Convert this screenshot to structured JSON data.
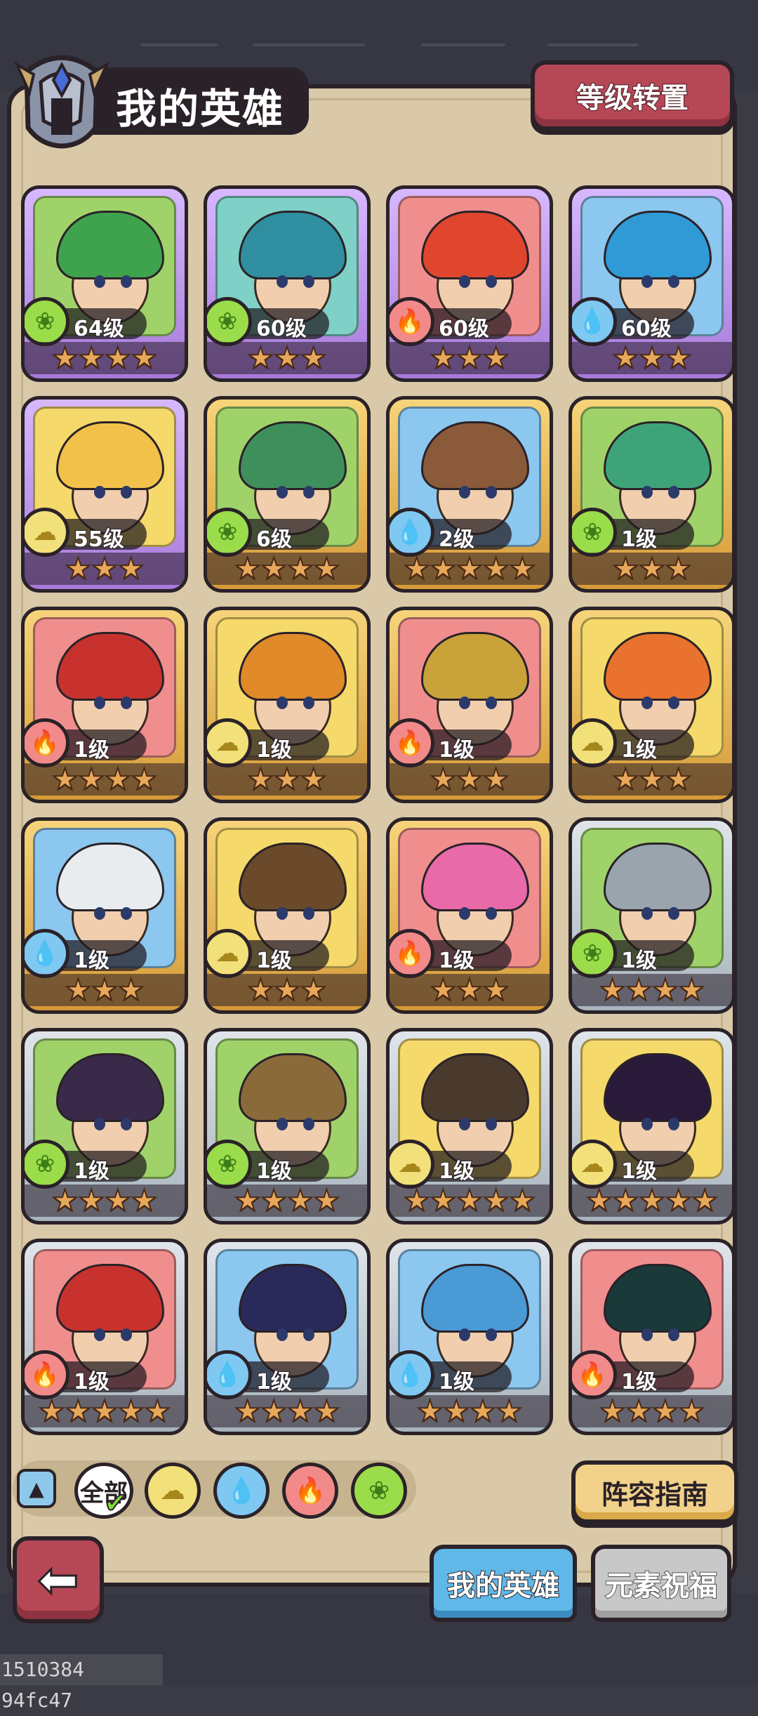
{
  "header": {
    "title": "我的英雄",
    "transfer_label": "等级转置"
  },
  "heroes": [
    {
      "level": "64级",
      "element": "nature",
      "stars": 4,
      "rarity": "purple",
      "bg": "#9fd36a",
      "hair": "#3fa34d"
    },
    {
      "level": "60级",
      "element": "nature",
      "stars": 3,
      "rarity": "purple",
      "bg": "#7fd0c6",
      "hair": "#2f8fa0"
    },
    {
      "level": "60级",
      "element": "fire",
      "stars": 3,
      "rarity": "purple",
      "bg": "#f08e8e",
      "hair": "#e0452e"
    },
    {
      "level": "60级",
      "element": "water",
      "stars": 3,
      "rarity": "purple",
      "bg": "#8cc7ef",
      "hair": "#2f9ad6"
    },
    {
      "level": "55级",
      "element": "earth",
      "stars": 3,
      "rarity": "purple",
      "bg": "#f5d96a",
      "hair": "#f2c14a"
    },
    {
      "level": "6级",
      "element": "nature",
      "stars": 4,
      "rarity": "gold",
      "bg": "#9fd36a",
      "hair": "#3f8f5d"
    },
    {
      "level": "2级",
      "element": "water",
      "stars": 5,
      "rarity": "gold",
      "bg": "#8cc7ef",
      "hair": "#8a5a3a"
    },
    {
      "level": "1级",
      "element": "nature",
      "stars": 3,
      "rarity": "gold",
      "bg": "#9fd36a",
      "hair": "#3fa37a"
    },
    {
      "level": "1级",
      "element": "fire",
      "stars": 4,
      "rarity": "gold",
      "bg": "#f08e8e",
      "hair": "#c8322e"
    },
    {
      "level": "1级",
      "element": "earth",
      "stars": 3,
      "rarity": "gold",
      "bg": "#f5d96a",
      "hair": "#e08a2a"
    },
    {
      "level": "1级",
      "element": "fire",
      "stars": 3,
      "rarity": "gold",
      "bg": "#f08e8e",
      "hair": "#c9a23a"
    },
    {
      "level": "1级",
      "element": "earth",
      "stars": 3,
      "rarity": "gold",
      "bg": "#f5d96a",
      "hair": "#e8722e"
    },
    {
      "level": "1级",
      "element": "water",
      "stars": 3,
      "rarity": "gold",
      "bg": "#8cc7ef",
      "hair": "#e8ecef"
    },
    {
      "level": "1级",
      "element": "earth",
      "stars": 3,
      "rarity": "gold",
      "bg": "#f5d96a",
      "hair": "#6a4a2a"
    },
    {
      "level": "1级",
      "element": "fire",
      "stars": 3,
      "rarity": "gold",
      "bg": "#f08e8e",
      "hair": "#e86aa8"
    },
    {
      "level": "1级",
      "element": "nature",
      "stars": 4,
      "rarity": "silver",
      "bg": "#9fd36a",
      "hair": "#9aa4ac"
    },
    {
      "level": "1级",
      "element": "nature",
      "stars": 4,
      "rarity": "silver",
      "bg": "#9fd36a",
      "hair": "#3a2a4a"
    },
    {
      "level": "1级",
      "element": "nature",
      "stars": 4,
      "rarity": "silver",
      "bg": "#9fd36a",
      "hair": "#8a6a3a"
    },
    {
      "level": "1级",
      "element": "earth",
      "stars": 5,
      "rarity": "silver",
      "bg": "#f5d96a",
      "hair": "#4a3a2e"
    },
    {
      "level": "1级",
      "element": "earth",
      "stars": 5,
      "rarity": "silver",
      "bg": "#f5d96a",
      "hair": "#2a1a3a"
    },
    {
      "level": "1级",
      "element": "fire",
      "stars": 5,
      "rarity": "silver",
      "bg": "#f08e8e",
      "hair": "#c8322e"
    },
    {
      "level": "1级",
      "element": "water",
      "stars": 4,
      "rarity": "silver",
      "bg": "#8cc7ef",
      "hair": "#2a2a5a"
    },
    {
      "level": "1级",
      "element": "water",
      "stars": 4,
      "rarity": "silver",
      "bg": "#8cc7ef",
      "hair": "#4a9ad6"
    },
    {
      "level": "1级",
      "element": "fire",
      "stars": 4,
      "rarity": "silver",
      "bg": "#f08e8e",
      "hair": "#1a3a3a"
    }
  ],
  "filter": {
    "all_label": "全部",
    "elements": [
      "earth",
      "water",
      "fire",
      "nature"
    ]
  },
  "guide_label": "阵容指南",
  "tabs": {
    "my_heroes": "我的英雄",
    "element_blessing": "元素祝福"
  },
  "watermark": "1510384 94fc47",
  "icons": {
    "nature": "leaf-swirl-icon",
    "water": "water-drop-icon",
    "fire": "flame-icon",
    "earth": "earth-cloud-icon"
  }
}
